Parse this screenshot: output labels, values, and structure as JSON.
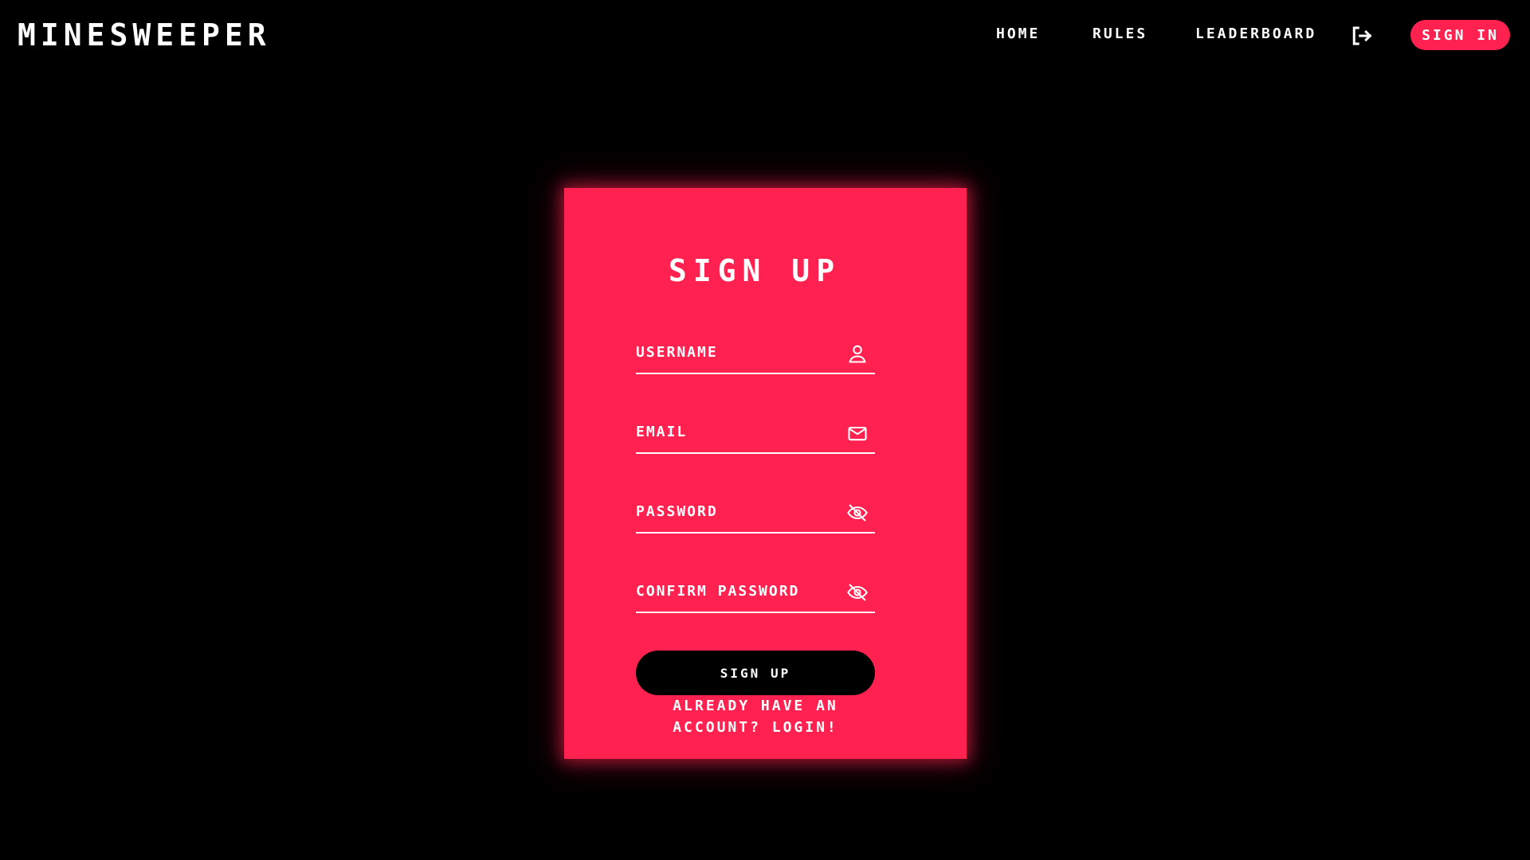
{
  "app": {
    "title": "MINESWEEPER"
  },
  "nav": {
    "home": "HOME",
    "rules": "RULES",
    "leaderboard": "LEADERBOARD",
    "logout_icon": "logout-icon",
    "signin": "SIGN IN"
  },
  "signup": {
    "title": "SIGN UP",
    "fields": {
      "username": {
        "placeholder": "USERNAME",
        "value": "",
        "icon": "user-icon"
      },
      "email": {
        "placeholder": "EMAIL",
        "value": "",
        "icon": "mail-icon"
      },
      "password": {
        "placeholder": "PASSWORD",
        "value": "",
        "icon": "eye-off-icon"
      },
      "confirm_password": {
        "placeholder": "CONFIRM PASSWORD",
        "value": "",
        "icon": "eye-off-icon"
      }
    },
    "submit_label": "SIGN UP",
    "login_prompt_line1": "ALREADY HAVE AN",
    "login_prompt_line2": "ACCOUNT? LOGIN!"
  },
  "colors": {
    "background": "#000000",
    "accent": "#ff2150",
    "text": "#ffffff"
  }
}
